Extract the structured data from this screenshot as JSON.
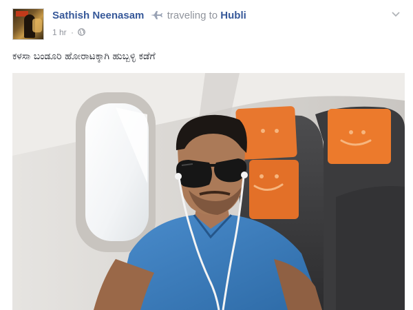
{
  "post": {
    "author_name": "Sathish Neenasam",
    "activity_icon": "plane-icon",
    "activity_text": "traveling to",
    "destination": "Hubli",
    "timestamp": "1 hr",
    "separator": "·",
    "privacy_icon": "globe-icon",
    "options_icon": "chevron-down-icon",
    "text": "ಕಳಸಾ ಬಂಡೂರಿ ಹೋರಾಟಕ್ಕಾಗಿ ಹುಬ್ಬಳ್ಳಿ ಕಡೆಗೆ"
  },
  "colors": {
    "link": "#365899",
    "meta": "#90949c",
    "text": "#1d2129",
    "seat_orange": "#e8772e",
    "shirt_blue": "#3a7ab8"
  }
}
